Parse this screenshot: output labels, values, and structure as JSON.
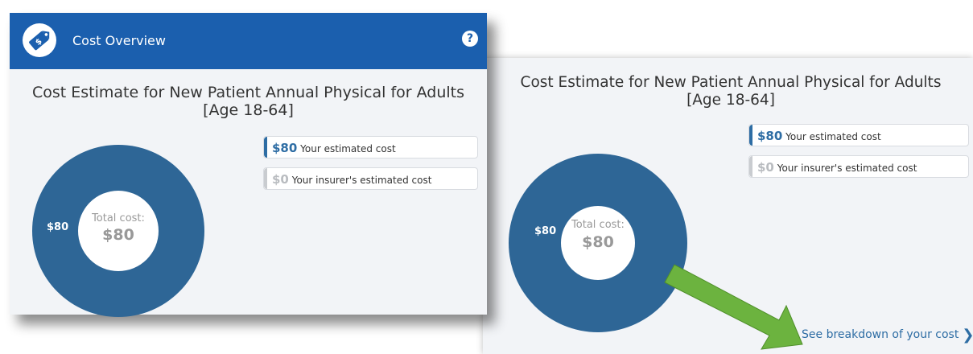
{
  "colors": {
    "header_bg": "#1b5fae",
    "donut": "#2e6696",
    "accent_blue": "#2e6da4",
    "muted_grey": "#b9bcc0",
    "arrow_green": "#6cb33f"
  },
  "left_card": {
    "header": {
      "title": "Cost Overview",
      "logo_icon": "price-tag-logo-icon",
      "help_icon": "question-circle-icon",
      "help_glyph": "?"
    },
    "estimate_title_line1": "Cost Estimate for New Patient Annual Physical for Adults",
    "estimate_title_line2": "[Age 18-64]",
    "legend": [
      {
        "amount": "$80",
        "label": "Your estimated cost"
      },
      {
        "amount": "$0",
        "label": "Your insurer's estimated cost"
      }
    ],
    "donut": {
      "slice_label": "$80",
      "center_label": "Total cost:",
      "center_value": "$80"
    }
  },
  "right_panel": {
    "estimate_title_line1": "Cost Estimate for New Patient Annual Physical for Adults",
    "estimate_title_line2": "[Age 18-64]",
    "legend": [
      {
        "amount": "$80",
        "label": "Your estimated cost"
      },
      {
        "amount": "$0",
        "label": "Your insurer's estimated cost"
      }
    ],
    "donut": {
      "slice_label": "$80",
      "center_label": "Total cost:",
      "center_value": "$80"
    },
    "breakdown_link": "See breakdown of your cost",
    "breakdown_chevron": "❯"
  }
}
